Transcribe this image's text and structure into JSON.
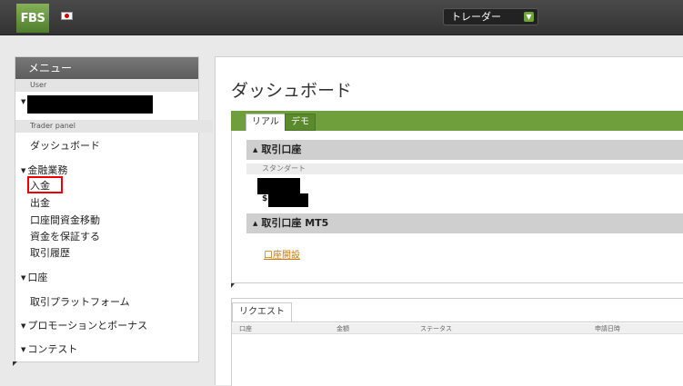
{
  "header": {
    "logo_text": "FBS",
    "account_type_selector": "トレーダー"
  },
  "sidebar": {
    "title": "メニュー",
    "user_section": "User",
    "trader_panel_section": "Trader panel",
    "dashboard": "ダッシュボード",
    "financial_ops": {
      "label": "金融業務",
      "items": [
        "入金",
        "出金",
        "口座間資金移動",
        "資金を保証する",
        "取引履歴"
      ]
    },
    "accounts": "口座",
    "trading_platforms": "取引プラットフォーム",
    "promotions": "プロモーションとボーナス",
    "contests": "コンテスト"
  },
  "main": {
    "title": "ダッシュボード",
    "tabs": [
      "リアル",
      "デモ"
    ],
    "trading_accounts_header": "取引口座",
    "standard_label": "スタンダート",
    "currency_symbol": "$",
    "mt5_header": "取引口座 MT5",
    "open_account_link": "口座開設",
    "request_tab": "リクエスト",
    "request_columns": [
      "口座",
      "金額",
      "ステータス",
      "申請日時"
    ]
  },
  "colors": {
    "accent_green": "#6e9f3c",
    "highlight_red": "#e00000",
    "link_orange": "#cc7a00"
  }
}
